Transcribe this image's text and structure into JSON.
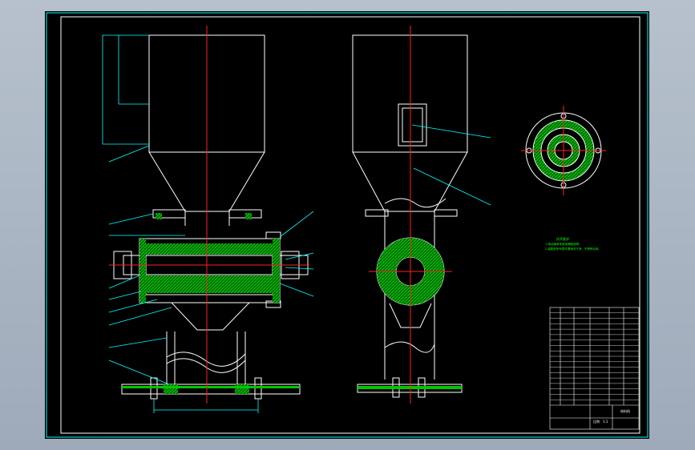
{
  "notes": {
    "heading": "技术要求",
    "lines": [
      "1.滚动轴承采用润滑脂润滑。",
      "2.装配前所有零件需清洗干净，不得有毛刺。"
    ]
  },
  "title_block": {
    "drawing_name": "给料机",
    "scale": "比例",
    "sheet": "1:1"
  },
  "parts_list_rows": 18,
  "colors": {
    "outline": "#ffffff",
    "centerline": "#ff2020",
    "leader": "#00ffff",
    "hatch": "#00c800",
    "border": "#ffffff",
    "dimension": "#00ffff"
  }
}
